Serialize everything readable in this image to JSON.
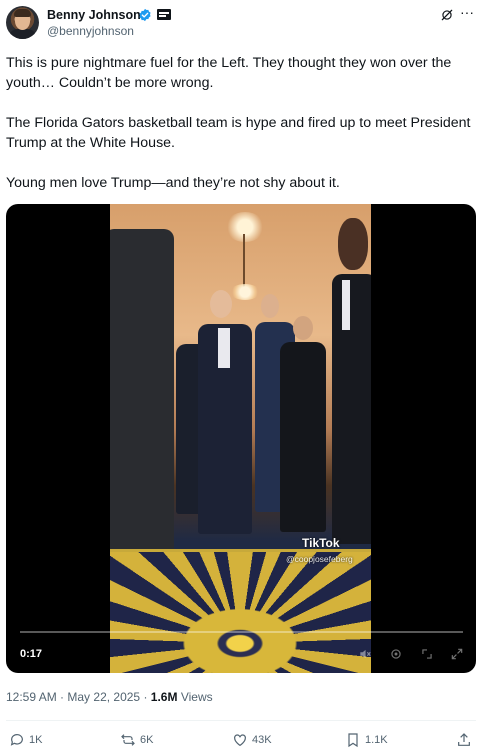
{
  "author": {
    "display_name": "Benny Johnson",
    "handle": "@bennyjohnson",
    "verified_icon": "verified-badge-icon",
    "affiliation_icon": "media-affiliation-icon"
  },
  "header_actions": {
    "grok_icon": "grok-icon",
    "more_icon": "more-options-icon",
    "more_label": "···"
  },
  "tweet": {
    "paragraph_1": "This is pure nightmare fuel for the Left. They thought they won over the youth… Couldn’t be more wrong.",
    "paragraph_2": "The Florida Gators basketball team is hype and fired up to meet President Trump at the White House.",
    "paragraph_3": "Young men love Trump—and they’re not shy about it."
  },
  "video": {
    "elapsed": "0:17",
    "progress": 0.0,
    "watermark_logo": "TikTok",
    "watermark_handle": "@coopjosefeberg",
    "controls": [
      "volume-icon",
      "settings-icon",
      "fullscreen-minimize-icon",
      "fullscreen-icon"
    ]
  },
  "meta": {
    "time": "12:59 AM",
    "date": "May 22, 2025",
    "views_count": "1.6M",
    "views_label": "Views",
    "separator": "·"
  },
  "actions": {
    "reply_count": "1K",
    "repost_count": "6K",
    "like_count": "43K",
    "bookmark_count": "1.1K"
  },
  "colors": {
    "text": "#0f1419",
    "secondary": "#536471",
    "verified": "#1d9bf0",
    "divider": "#eff3f4"
  }
}
